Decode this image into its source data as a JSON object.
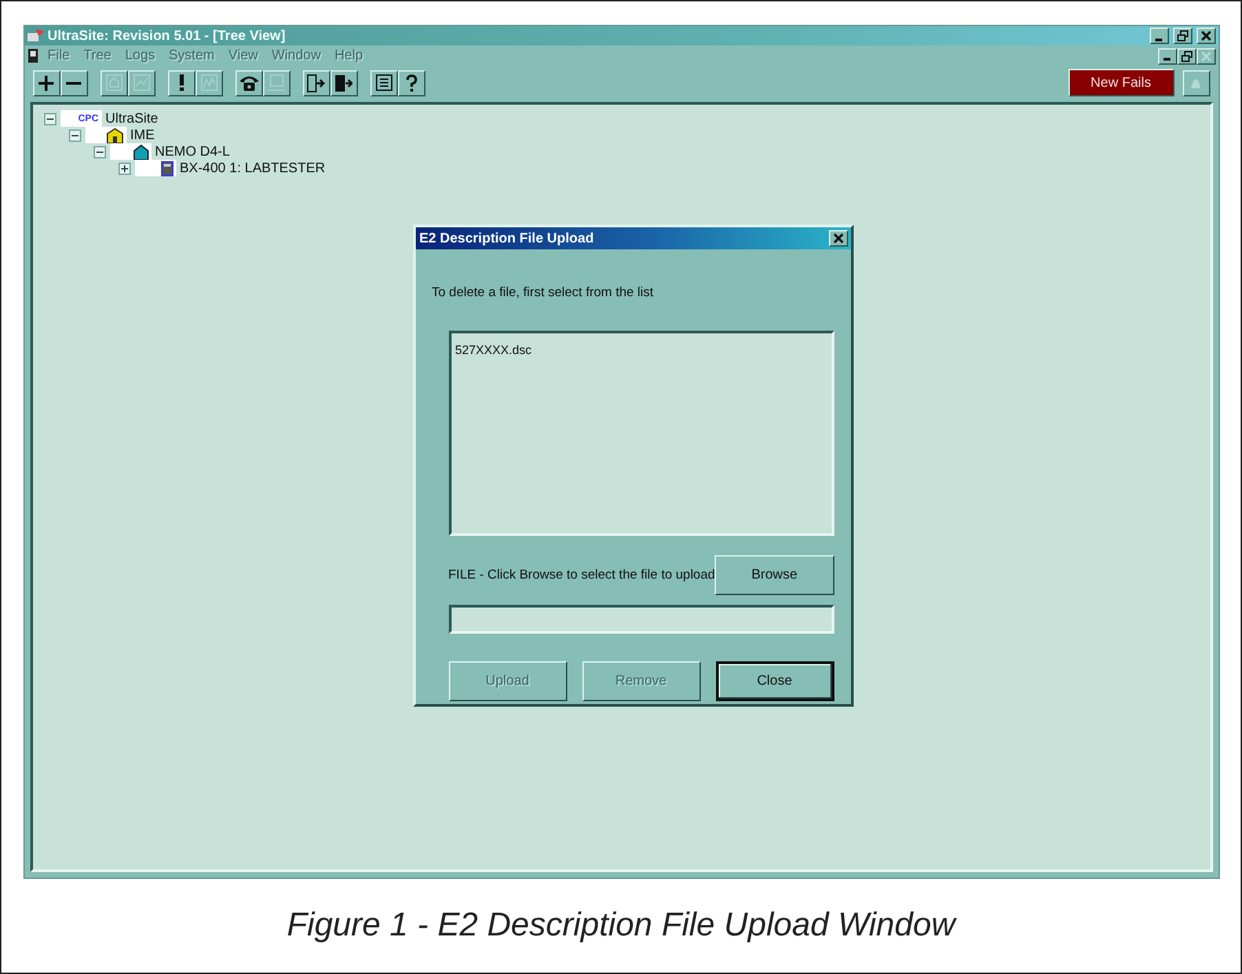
{
  "window": {
    "title": "UltraSite: Revision 5.01 - [Tree View]"
  },
  "menu": [
    {
      "label": "File",
      "disabled": true
    },
    {
      "label": "Tree",
      "disabled": true
    },
    {
      "label": "Logs",
      "disabled": true
    },
    {
      "label": "System",
      "disabled": true
    },
    {
      "label": "View",
      "disabled": true
    },
    {
      "label": "Window",
      "disabled": true
    },
    {
      "label": "Help",
      "disabled": true
    }
  ],
  "toolbar": [
    {
      "kind": "plus",
      "disabled": false
    },
    {
      "kind": "minus",
      "disabled": false
    },
    {
      "kind": "sep"
    },
    {
      "kind": "house",
      "disabled": true
    },
    {
      "kind": "chart",
      "disabled": true
    },
    {
      "kind": "sep"
    },
    {
      "kind": "alert",
      "disabled": false
    },
    {
      "kind": "graph",
      "disabled": true
    },
    {
      "kind": "sep"
    },
    {
      "kind": "phone",
      "disabled": false
    },
    {
      "kind": "monitor",
      "disabled": true
    },
    {
      "kind": "sep"
    },
    {
      "kind": "door-in",
      "disabled": false
    },
    {
      "kind": "door-out",
      "disabled": false
    },
    {
      "kind": "sep"
    },
    {
      "kind": "list",
      "disabled": false
    },
    {
      "kind": "help",
      "disabled": false
    }
  ],
  "alarm_button": {
    "label": "New Fails"
  },
  "tree": [
    {
      "label": "UltraSite",
      "icon_text": "CPC",
      "kind": "root",
      "expanded": true,
      "children": [
        {
          "label": "IME",
          "kind": "site",
          "expanded": true,
          "children": [
            {
              "label": "NEMO D4-L",
              "kind": "unit",
              "expanded": true,
              "children": [
                {
                  "label": "BX-400 1: LABTESTER",
                  "kind": "controller",
                  "expanded": false
                }
              ]
            }
          ]
        }
      ]
    }
  ],
  "dialog": {
    "title": "E2 Description File Upload",
    "instruction": "To delete a file, first select from the list",
    "files": [
      {
        "name": "527XXXX.dsc",
        "selected": false
      }
    ],
    "file_label": "FILE - Click Browse to select the file to upload",
    "browse_button": "Browse",
    "buttons": [
      {
        "label": "Upload",
        "disabled": true,
        "default": false
      },
      {
        "label": "Remove",
        "disabled": true,
        "default": false
      },
      {
        "label": "Close",
        "disabled": false,
        "default": true
      }
    ]
  },
  "caption": "Figure 1 - E2 Description File Upload Window"
}
